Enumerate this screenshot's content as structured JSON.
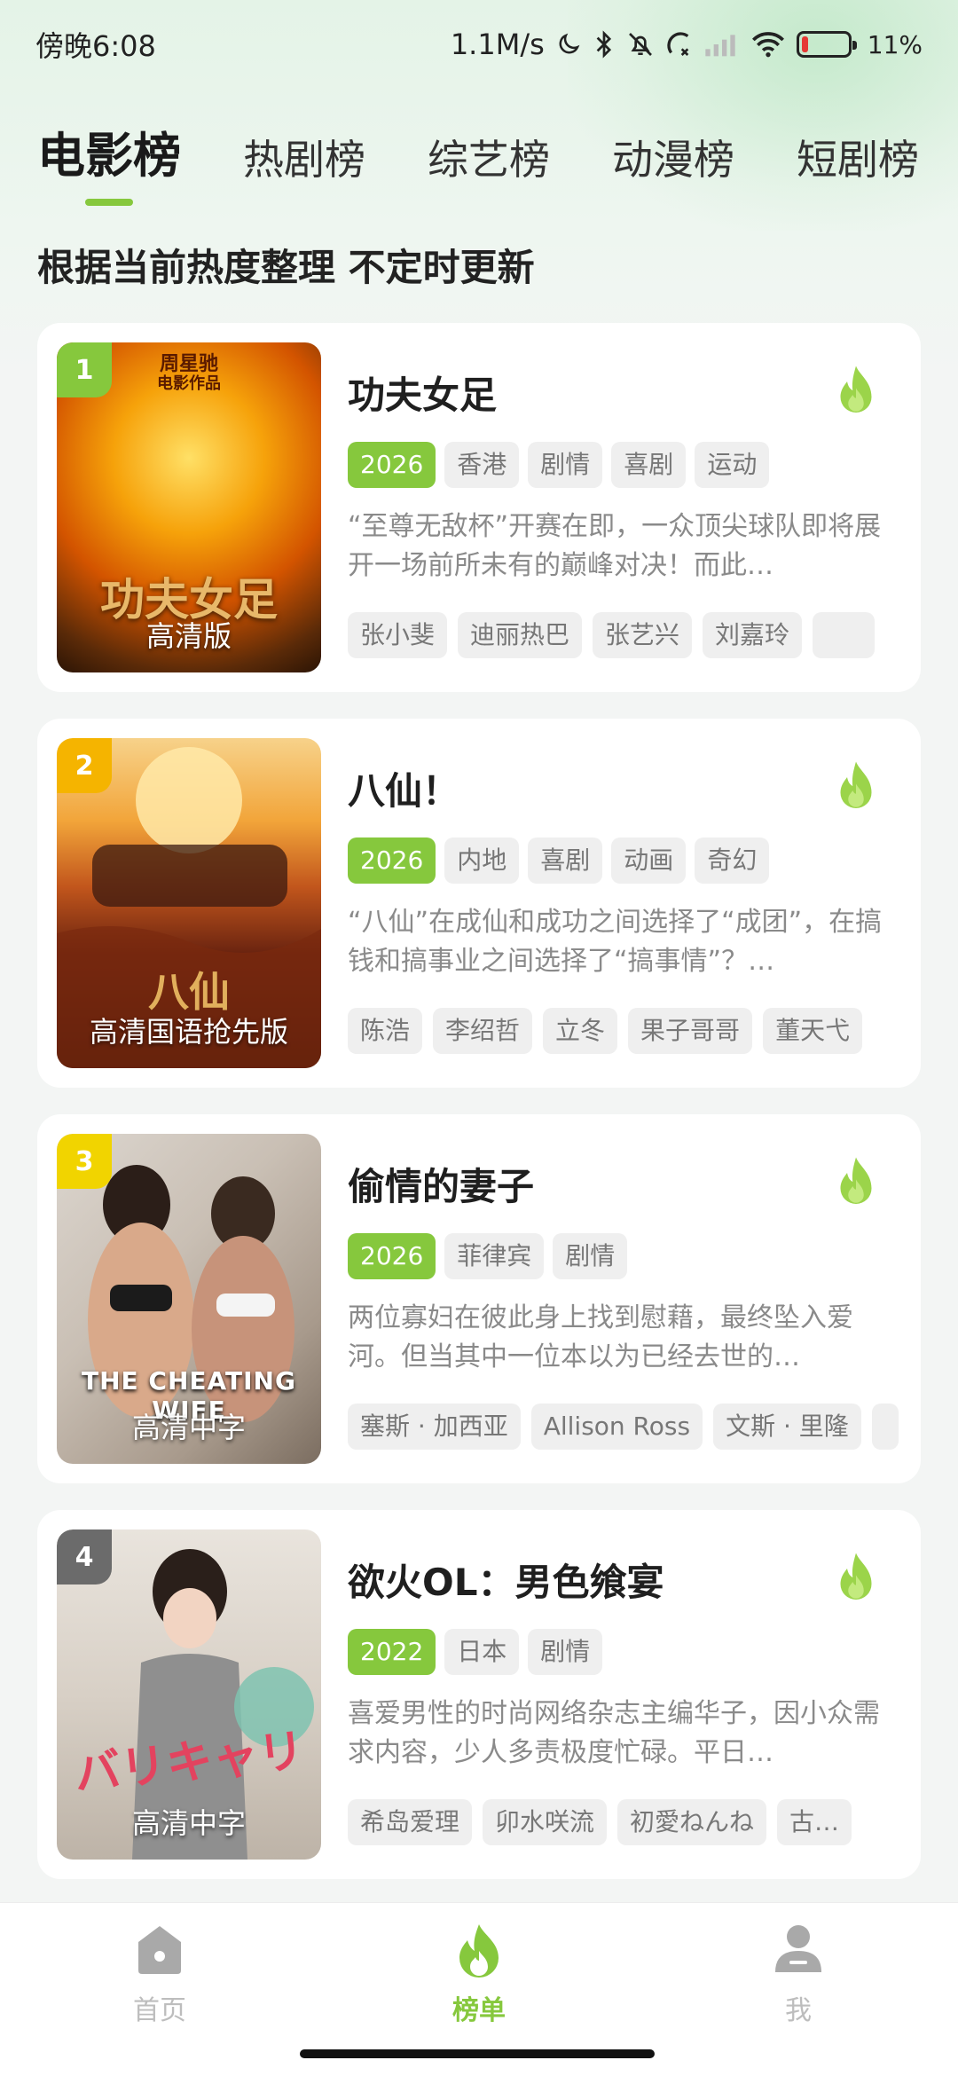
{
  "status": {
    "time": "傍晚6:08",
    "network_speed": "1.1M/s",
    "battery": "11%"
  },
  "tabs": [
    {
      "label": "电影榜",
      "active": true
    },
    {
      "label": "热剧榜"
    },
    {
      "label": "综艺榜"
    },
    {
      "label": "动漫榜"
    },
    {
      "label": "短剧榜"
    }
  ],
  "subtitle": "根据当前热度整理 不定时更新",
  "colors": {
    "accent": "#86c83d",
    "rank1": "#86c83d",
    "rank2": "#f5b400",
    "rank3": "#f1d400",
    "rank4": "#6b6b6b"
  },
  "items": [
    {
      "rank": "1",
      "title": "功夫女足",
      "quality": "高清版",
      "poster_text": "功夫女足",
      "poster_brand": "周星驰",
      "poster_tagline": "电影作品",
      "year": "2026",
      "tags": [
        "香港",
        "剧情",
        "喜剧",
        "运动"
      ],
      "desc": "“至尊无敌杯”开赛在即，一众顶尖球队即将展开一场前所未有的巅峰对决！而此…",
      "cast": [
        "张小斐",
        "迪丽热巴",
        "张艺兴",
        "刘嘉玲",
        ""
      ]
    },
    {
      "rank": "2",
      "title": "八仙！",
      "quality": "高清国语抢先版",
      "poster_text": "八仙",
      "year": "2026",
      "tags": [
        "内地",
        "喜剧",
        "动画",
        "奇幻"
      ],
      "desc": "“八仙”在成仙和成功之间选择了“成团”，在搞钱和搞事业之间选择了“搞事情”？…",
      "cast": [
        "陈浩",
        "李绍哲",
        "立冬",
        "果子哥哥",
        "董天弋"
      ]
    },
    {
      "rank": "3",
      "title": "偷情的妻子",
      "quality": "高清中字",
      "poster_text": "THE CHEATING WIFE",
      "year": "2026",
      "tags": [
        "菲律宾",
        "剧情"
      ],
      "desc": "两位寡妇在彼此身上找到慰藉，最终坠入爱河。但当其中一位本以为已经去世的…",
      "cast": [
        "塞斯 · 加西亚",
        "Allison Ross",
        "文斯 · 里隆",
        ""
      ]
    },
    {
      "rank": "4",
      "title": "欲火OL：男色飨宴",
      "quality": "高清中字",
      "poster_text": "バリキャリ",
      "year": "2022",
      "tags": [
        "日本",
        "剧情"
      ],
      "desc": "喜爱男性的时尚网络杂志主编华子，因小众需求内容，少人多责极度忙碌。平日…",
      "cast": [
        "希岛爱理",
        "卯水咲流",
        "初愛ねんね",
        "古…"
      ]
    }
  ],
  "nav": [
    {
      "label": "首页",
      "icon": "home-icon"
    },
    {
      "label": "榜单",
      "icon": "flame-icon",
      "active": true
    },
    {
      "label": "我",
      "icon": "profile-icon"
    }
  ]
}
